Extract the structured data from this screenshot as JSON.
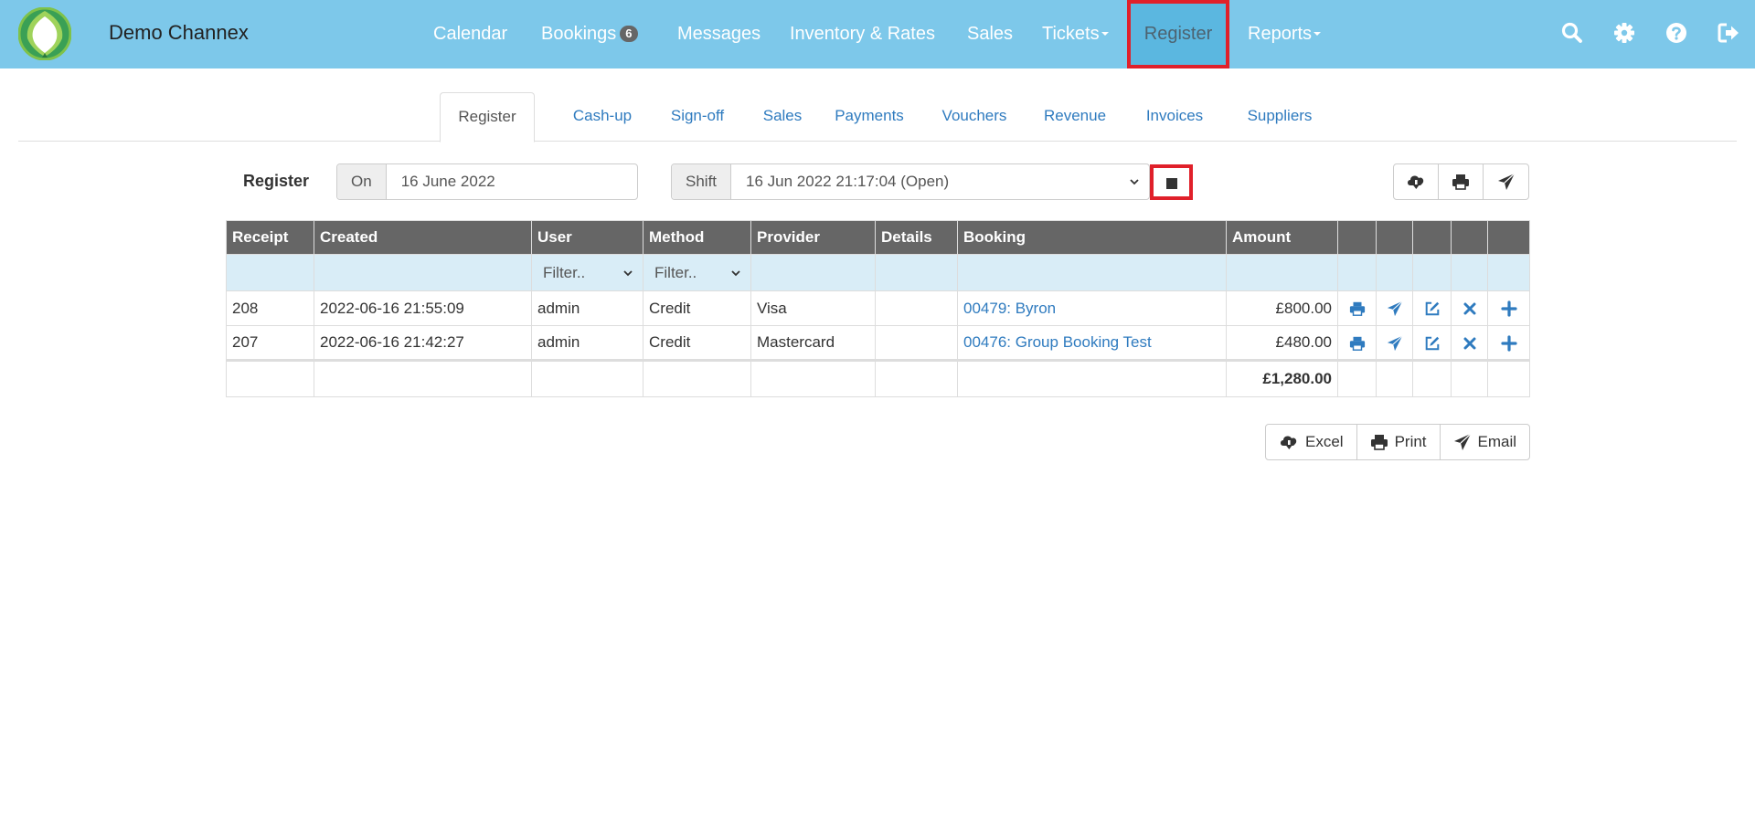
{
  "navbar": {
    "brand": "Demo Channex",
    "items": [
      {
        "label": "Calendar"
      },
      {
        "label": "Bookings",
        "badge": "6"
      },
      {
        "label": "Messages"
      },
      {
        "label": "Inventory & Rates"
      },
      {
        "label": "Sales"
      },
      {
        "label": "Tickets"
      },
      {
        "label": "Register"
      },
      {
        "label": "Reports"
      }
    ],
    "icons": [
      "search-icon",
      "gear-icon",
      "help-icon",
      "logout-icon"
    ],
    "colors": {
      "bar": "#7dc8ea",
      "active": "#5bb7e0",
      "highlight": "#e0202a"
    }
  },
  "tabs": [
    {
      "label": "Register"
    },
    {
      "label": "Cash-up"
    },
    {
      "label": "Sign-off"
    },
    {
      "label": "Sales"
    },
    {
      "label": "Payments"
    },
    {
      "label": "Vouchers"
    },
    {
      "label": "Revenue"
    },
    {
      "label": "Invoices"
    },
    {
      "label": "Suppliers"
    }
  ],
  "register": {
    "label": "Register",
    "date_addon": "On",
    "date_value": "16 June 2022",
    "shift_addon": "Shift",
    "shift_value": "16 Jun 2022 21:17:04 (Open)",
    "tools": [
      "download-icon",
      "print-icon",
      "send-icon"
    ]
  },
  "table": {
    "headers": [
      "Receipt",
      "Created",
      "User",
      "Method",
      "Provider",
      "Details",
      "Booking",
      "Amount"
    ],
    "filter_placeholder": "Filter..",
    "rows": [
      {
        "receipt": "208",
        "created": "2022-06-16 21:55:09",
        "user": "admin",
        "method": "Credit",
        "provider": "Visa",
        "details": "",
        "booking": "00479: Byron",
        "amount": "£800.00"
      },
      {
        "receipt": "207",
        "created": "2022-06-16 21:42:27",
        "user": "admin",
        "method": "Credit",
        "provider": "Mastercard",
        "details": "",
        "booking": "00476: Group Booking Test",
        "amount": "£480.00"
      }
    ],
    "row_actions": [
      "print-icon",
      "send-icon",
      "edit-icon",
      "delete-icon",
      "add-icon"
    ],
    "total": "£1,280.00"
  },
  "export": {
    "excel": "Excel",
    "print": "Print",
    "email": "Email"
  }
}
